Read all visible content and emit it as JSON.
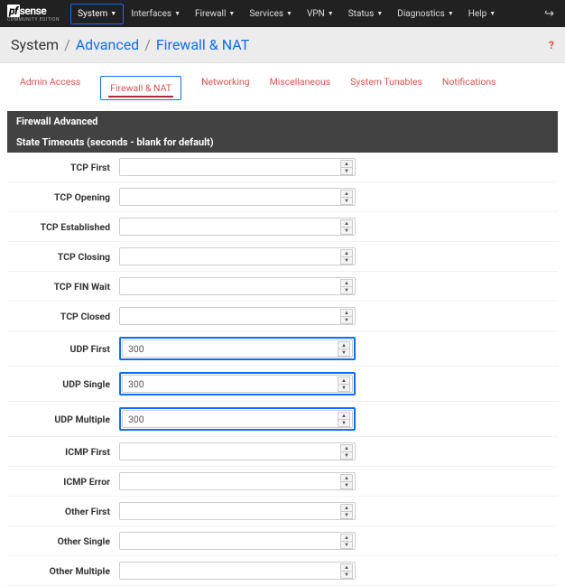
{
  "nav": {
    "items": [
      {
        "label": "System",
        "active": true
      },
      {
        "label": "Interfaces"
      },
      {
        "label": "Firewall"
      },
      {
        "label": "Services"
      },
      {
        "label": "VPN"
      },
      {
        "label": "Status"
      },
      {
        "label": "Diagnostics"
      },
      {
        "label": "Help"
      }
    ]
  },
  "breadcrumb": {
    "root": "System",
    "sep": "/",
    "mid": "Advanced",
    "leaf": "Firewall & NAT"
  },
  "tabs": [
    {
      "label": "Admin Access"
    },
    {
      "label": "Firewall & NAT",
      "active": true
    },
    {
      "label": "Networking"
    },
    {
      "label": "Miscellaneous"
    },
    {
      "label": "System Tunables"
    },
    {
      "label": "Notifications"
    }
  ],
  "sections": {
    "header1": "Firewall Advanced",
    "header2": "State Timeouts (seconds - blank for default)"
  },
  "rows": [
    {
      "label": "TCP First",
      "value": "",
      "hl": false
    },
    {
      "label": "TCP Opening",
      "value": "",
      "hl": false
    },
    {
      "label": "TCP Established",
      "value": "",
      "hl": false
    },
    {
      "label": "TCP Closing",
      "value": "",
      "hl": false
    },
    {
      "label": "TCP FIN Wait",
      "value": "",
      "hl": false
    },
    {
      "label": "TCP Closed",
      "value": "",
      "hl": false
    },
    {
      "label": "UDP First",
      "value": "300",
      "hl": true
    },
    {
      "label": "UDP Single",
      "value": "300",
      "hl": true
    },
    {
      "label": "UDP Multiple",
      "value": "300",
      "hl": true
    },
    {
      "label": "ICMP First",
      "value": "",
      "hl": false
    },
    {
      "label": "ICMP Error",
      "value": "",
      "hl": false
    },
    {
      "label": "Other First",
      "value": "",
      "hl": false
    },
    {
      "label": "Other Single",
      "value": "",
      "hl": false
    },
    {
      "label": "Other Multiple",
      "value": "",
      "hl": false
    }
  ]
}
